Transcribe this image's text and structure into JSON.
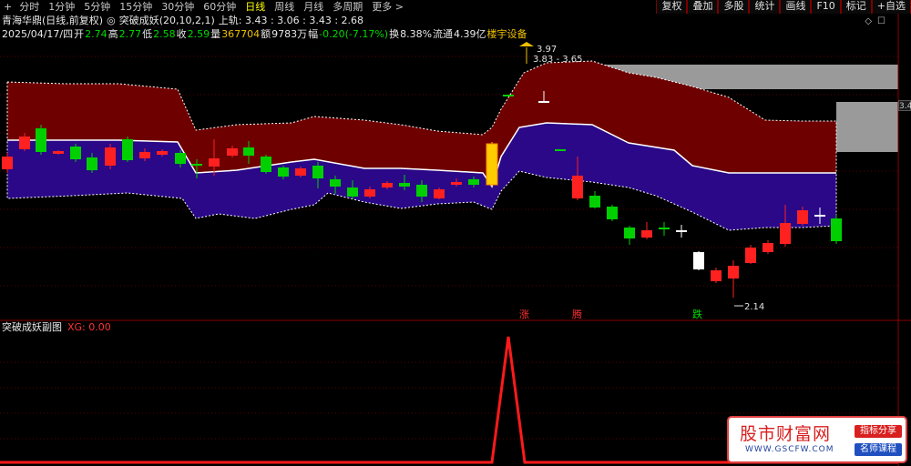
{
  "toolbar": {
    "icon": "+",
    "periods": [
      {
        "label": "分时",
        "active": false
      },
      {
        "label": "1分钟",
        "active": false
      },
      {
        "label": "5分钟",
        "active": false
      },
      {
        "label": "15分钟",
        "active": false
      },
      {
        "label": "30分钟",
        "active": false
      },
      {
        "label": "60分钟",
        "active": false
      },
      {
        "label": "日线",
        "active": true
      },
      {
        "label": "周线",
        "active": false
      },
      {
        "label": "月线",
        "active": false
      },
      {
        "label": "多周期",
        "active": false
      },
      {
        "label": "更多 >",
        "active": false
      }
    ],
    "right_buttons": [
      "复权",
      "叠加",
      "多股",
      "统计",
      "画线",
      "F10",
      "标记",
      "+自选"
    ]
  },
  "info": {
    "stock_name": "青海华鼎(日线,前复权)",
    "indicator_marker": "◎",
    "indicator_name": "突破成妖(20,10,2,1)",
    "upper_band": "上轨: 3.43 : 3.06 : 3.43 : 2.68",
    "date": "2025/04/17/四",
    "open_label": "开",
    "open": "2.74",
    "high_label": "高",
    "high": "2.77",
    "low_label": "低",
    "low": "2.58",
    "close_label": "收",
    "close": "2.59",
    "volume_label": "量",
    "volume": "367704",
    "amount_label": "额",
    "amount": "9783万",
    "change_label": "幅",
    "change": "-0.20(-7.17%)",
    "turnover_label": "换",
    "turnover": "8.38%",
    "float_label": "流通",
    "float_cap": "4.39亿",
    "sector": "楼宇设备"
  },
  "chart_data": {
    "type": "candlestick",
    "price_labels": {
      "high_marker": "3.97",
      "range_marker": "3.83 - 3.65",
      "low_marker": "2.14"
    },
    "signal_labels": [
      "涨",
      "腾",
      "跌"
    ],
    "price_tag": "3.4",
    "sub_indicator": {
      "name": "突破成妖副图",
      "series_label": "XG: 0.00",
      "type": "line",
      "values_note": "single spike to 1 at the breakout day, 0 elsewhere"
    }
  },
  "colors": {
    "up": "#ff2020",
    "down": "#00d000",
    "upper_band_fill": "#6e0000",
    "lower_band_fill": "#2a0888",
    "grey_zone": "#9a9a9a",
    "accent": "#ffcc00"
  },
  "watermark": {
    "main": "股市财富网",
    "url": "WWW.GSCFW.COM",
    "tag1": "指标分享",
    "tag2": "名师课程"
  }
}
